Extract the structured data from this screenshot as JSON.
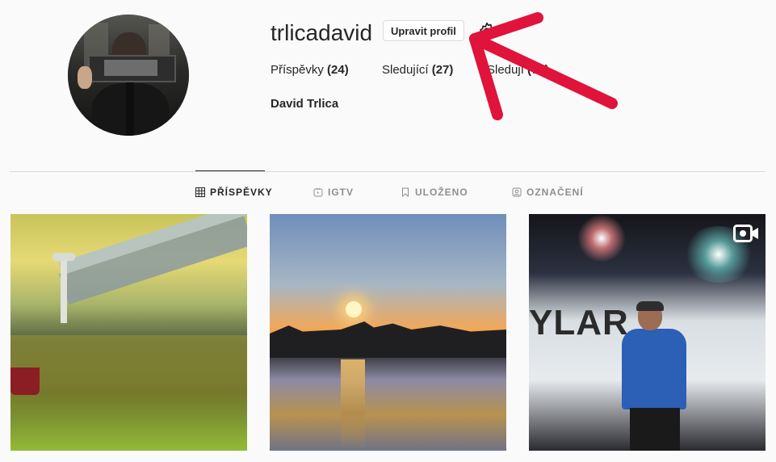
{
  "profile": {
    "username": "trlicadavid",
    "edit_button": "Upravit profil",
    "full_name": "David Trlica",
    "stats": {
      "posts_label": "Příspěvky",
      "posts_count": "(24)",
      "followers_label": "Sledující",
      "followers_count": "(27)",
      "following_label": "Sledují",
      "following_count": "(74)"
    }
  },
  "tabs": [
    {
      "label": "PŘÍSPĚVKY",
      "icon": "grid-icon",
      "active": true
    },
    {
      "label": "IGTV",
      "icon": "igtv-icon",
      "active": false
    },
    {
      "label": "ULOŽENO",
      "icon": "bookmark-icon",
      "active": false
    },
    {
      "label": "OZNAČENÍ",
      "icon": "tagged-icon",
      "active": false
    }
  ],
  "posts": {
    "post3_overlay_text": "YLAR"
  },
  "annotation": {
    "arrow_color": "#e0133a"
  }
}
